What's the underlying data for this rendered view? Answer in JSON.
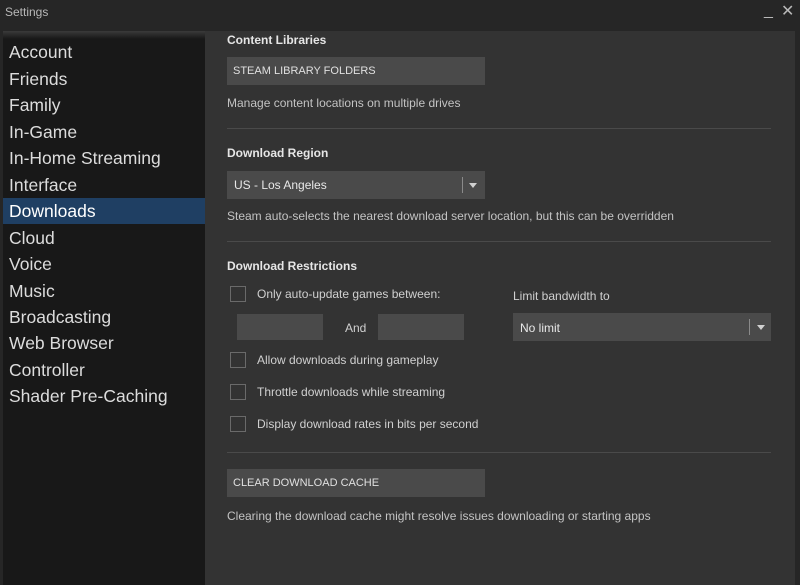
{
  "window": {
    "title": "Settings",
    "minimize_glyph": "_",
    "close_glyph": "✕"
  },
  "sidebar": {
    "items": [
      {
        "label": "Account"
      },
      {
        "label": "Friends"
      },
      {
        "label": "Family"
      },
      {
        "label": "In-Game"
      },
      {
        "label": "In-Home Streaming"
      },
      {
        "label": "Interface"
      },
      {
        "label": "Downloads",
        "active": true
      },
      {
        "label": "Cloud"
      },
      {
        "label": "Voice"
      },
      {
        "label": "Music"
      },
      {
        "label": "Broadcasting"
      },
      {
        "label": "Web Browser"
      },
      {
        "label": "Controller"
      },
      {
        "label": "Shader Pre-Caching"
      }
    ]
  },
  "content_libraries": {
    "title": "Content Libraries",
    "button_label": "STEAM LIBRARY FOLDERS",
    "description": "Manage content locations on multiple drives"
  },
  "download_region": {
    "title": "Download Region",
    "selected": "US - Los Angeles",
    "description": "Steam auto-selects the nearest download server location, but this can be overridden"
  },
  "download_restrictions": {
    "title": "Download Restrictions",
    "auto_update_label": "Only auto-update games between:",
    "between_from": "",
    "and_label": "And",
    "between_to": "",
    "bandwidth_label": "Limit bandwidth to",
    "bandwidth_selected": "No limit",
    "allow_gameplay_label": "Allow downloads during gameplay",
    "throttle_label": "Throttle downloads while streaming",
    "bits_label": "Display download rates in bits per second"
  },
  "cache": {
    "button_label": "CLEAR DOWNLOAD CACHE",
    "description": "Clearing the download cache might resolve issues downloading or starting apps"
  },
  "colors": {
    "window_bg": "#262626",
    "sidebar_bg": "#181818",
    "active_item": "#1f3f63",
    "panel_bg": "#333333",
    "control_bg": "#4a4a4a"
  }
}
